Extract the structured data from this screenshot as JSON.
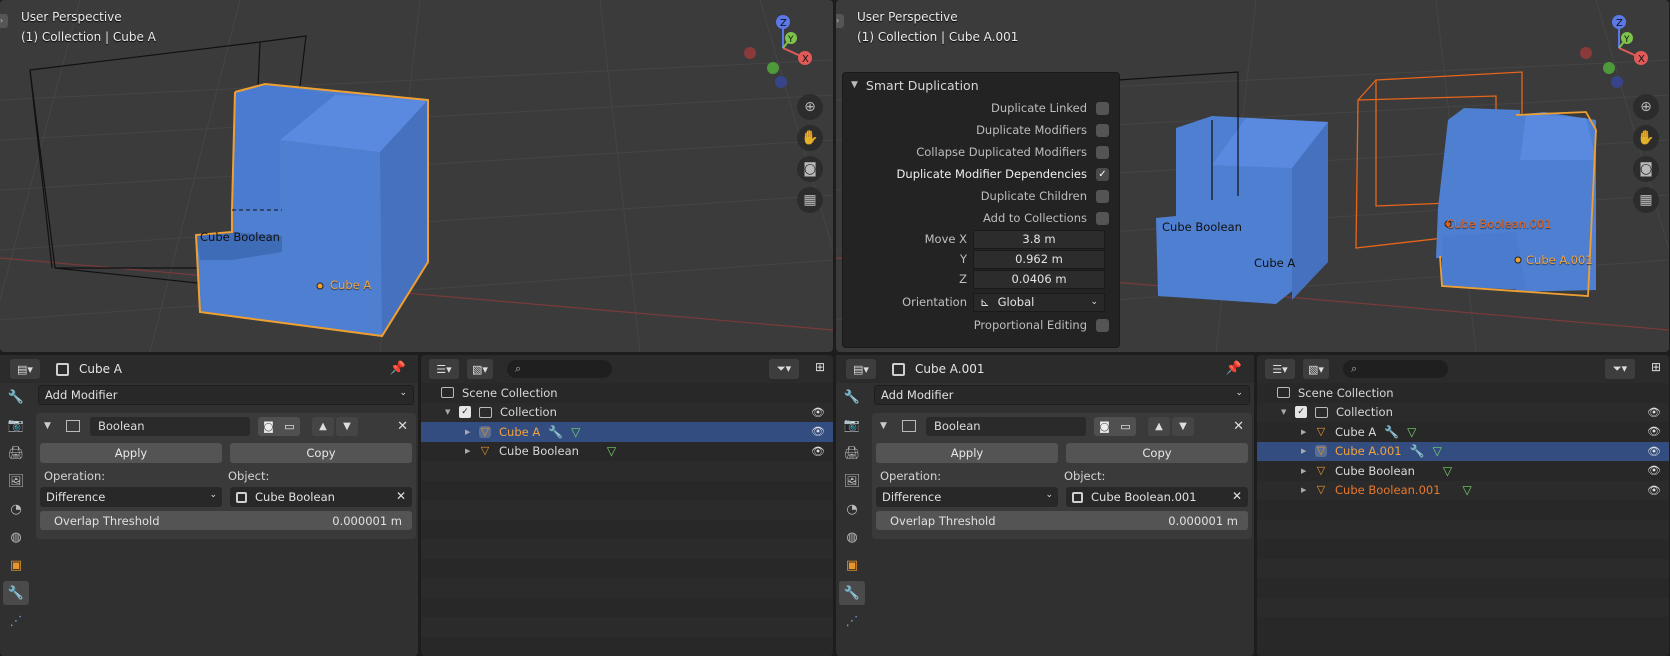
{
  "left": {
    "viewport": {
      "title": "User Perspective",
      "subtitle": "(1) Collection | Cube A",
      "labels": {
        "cube_boolean": "Cube Boolean",
        "cube_a": "Cube A"
      }
    },
    "properties": {
      "object_name": "Cube A",
      "add_modifier": "Add Modifier",
      "modifier_name": "Boolean",
      "apply": "Apply",
      "copy": "Copy",
      "operation_label": "Operation:",
      "object_label": "Object:",
      "operation_value": "Difference",
      "object_value": "Cube Boolean",
      "overlap_label": "Overlap Threshold",
      "overlap_value": "0.000001 m"
    },
    "outliner": {
      "scene_collection": "Scene Collection",
      "collection": "Collection",
      "items": [
        "Cube A",
        "Cube Boolean"
      ]
    }
  },
  "right": {
    "viewport": {
      "title": "User Perspective",
      "subtitle": "(1) Collection | Cube A.001",
      "labels": {
        "cube_boolean": "Cube Boolean",
        "cube_a": "Cube A",
        "cube_boolean_001": "Cube Boolean.001",
        "cube_a_001": "Cube A.001"
      }
    },
    "smart_dup": {
      "title": "Smart Duplication",
      "options": [
        {
          "label": "Duplicate Linked",
          "checked": false
        },
        {
          "label": "Duplicate Modifiers",
          "checked": false
        },
        {
          "label": "Collapse Duplicated Modifiers",
          "checked": false
        },
        {
          "label": "Duplicate Modifier Dependencies",
          "checked": true
        },
        {
          "label": "Duplicate Children",
          "checked": false
        },
        {
          "label": "Add to Collections",
          "checked": false
        }
      ],
      "move_x_label": "Move X",
      "move_x": "3.8 m",
      "y_label": "Y",
      "y": "0.962 m",
      "z_label": "Z",
      "z": "0.0406 m",
      "orientation_label": "Orientation",
      "orientation": "Global",
      "proportional_label": "Proportional Editing"
    },
    "properties": {
      "object_name": "Cube A.001",
      "add_modifier": "Add Modifier",
      "modifier_name": "Boolean",
      "apply": "Apply",
      "copy": "Copy",
      "operation_label": "Operation:",
      "object_label": "Object:",
      "operation_value": "Difference",
      "object_value": "Cube Boolean.001",
      "overlap_label": "Overlap Threshold",
      "overlap_value": "0.000001 m"
    },
    "outliner": {
      "scene_collection": "Scene Collection",
      "collection": "Collection",
      "items": [
        "Cube A",
        "Cube A.001",
        "Cube Boolean",
        "Cube Boolean.001"
      ]
    }
  },
  "icons": {
    "gizmo_z": "Z",
    "gizmo_y": "Y",
    "gizmo_x": "X",
    "zoom": "zoom-icon",
    "hand": "hand-icon",
    "camera": "camera-icon",
    "grid": "grid-icon"
  },
  "colors": {
    "selected_row": "#334d80",
    "orange": "#f3a23a",
    "mesh_green": "#77d36a",
    "cube_blue": "#4f7fd0"
  }
}
